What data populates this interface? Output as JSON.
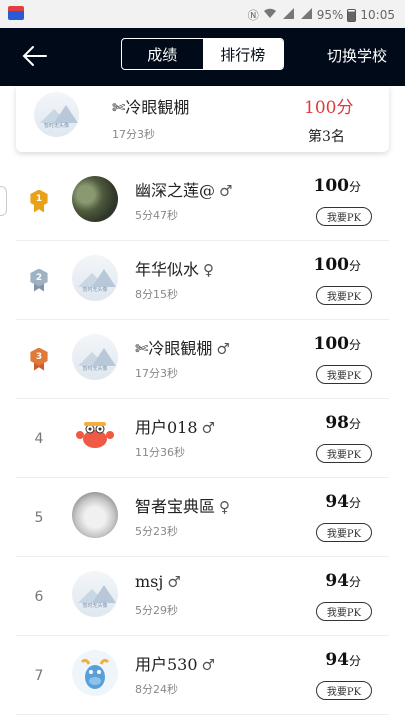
{
  "status_bar": {
    "battery": "95%",
    "time": "10:05",
    "icons": [
      "nfc-icon",
      "wifi-icon",
      "4g-signal-icon",
      "signal-icon",
      "battery-icon"
    ]
  },
  "header": {
    "tabs": [
      {
        "label": "成绩",
        "active": false
      },
      {
        "label": "排行榜",
        "active": true
      }
    ],
    "switch_label": "切换学校"
  },
  "my_entry": {
    "name": "✄冷眼観棚",
    "time": "17分3秒",
    "score": "100分",
    "rank": "第3名",
    "avatar_text": "暂时无头像"
  },
  "leaderboard": [
    {
      "rank": "1",
      "medal": "gold",
      "name": "幽深之莲@",
      "gender": "♂",
      "time": "5分47秒",
      "score": "100",
      "unit": "分",
      "pk": "我要PK",
      "avatar": "photo"
    },
    {
      "rank": "2",
      "medal": "silver",
      "name": "年华似水",
      "gender": "♀",
      "time": "8分15秒",
      "score": "100",
      "unit": "分",
      "pk": "我要PK",
      "avatar": "default",
      "avatar_text": "暂时无头像"
    },
    {
      "rank": "3",
      "medal": "bronze",
      "name": "✄冷眼観棚",
      "gender": "♂",
      "time": "17分3秒",
      "score": "100",
      "unit": "分",
      "pk": "我要PK",
      "avatar": "default",
      "avatar_text": "暂时无头像"
    },
    {
      "rank": "4",
      "medal": "",
      "name": "用户018",
      "gender": "♂",
      "time": "11分36秒",
      "score": "98",
      "unit": "分",
      "pk": "我要PK",
      "avatar": "crab"
    },
    {
      "rank": "5",
      "medal": "",
      "name": "智者宝典區",
      "gender": "♀",
      "time": "5分23秒",
      "score": "94",
      "unit": "分",
      "pk": "我要PK",
      "avatar": "cat"
    },
    {
      "rank": "6",
      "medal": "",
      "name": "msj",
      "gender": "♂",
      "time": "5分29秒",
      "score": "94",
      "unit": "分",
      "pk": "我要PK",
      "avatar": "default",
      "avatar_text": "暂时无头像"
    },
    {
      "rank": "7",
      "medal": "",
      "name": "用户530",
      "gender": "♂",
      "time": "8分24秒",
      "score": "94",
      "unit": "分",
      "pk": "我要PK",
      "avatar": "cow"
    }
  ],
  "colors": {
    "header_bg": "#000a18",
    "my_score": "#e2383e",
    "gold": "#e8a21a",
    "silver": "#9fb2c3",
    "bronze": "#e07a3a"
  }
}
